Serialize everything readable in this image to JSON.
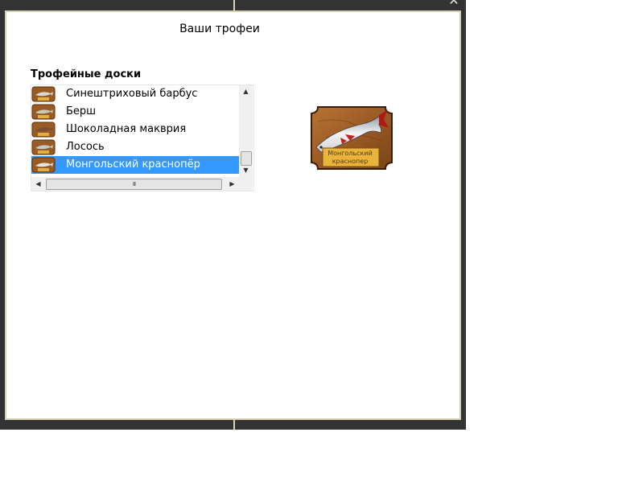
{
  "dialog": {
    "title": "Ваши трофеи",
    "section_label": "Трофейные доски"
  },
  "trophy_list": {
    "items": [
      {
        "label": "Синештриховый барбус",
        "selected": false
      },
      {
        "label": "Берш",
        "selected": false
      },
      {
        "label": "Шоколадная макврия",
        "selected": false
      },
      {
        "label": "Лосось",
        "selected": false
      },
      {
        "label": "Монгольский краснопёр",
        "selected": true
      }
    ],
    "hscroll_grip": "III"
  },
  "preview": {
    "plaque_text": "Монгольский краснопер"
  },
  "colors": {
    "frame": "#333333",
    "selection": "#3399ff",
    "wood": "#a0602a"
  }
}
